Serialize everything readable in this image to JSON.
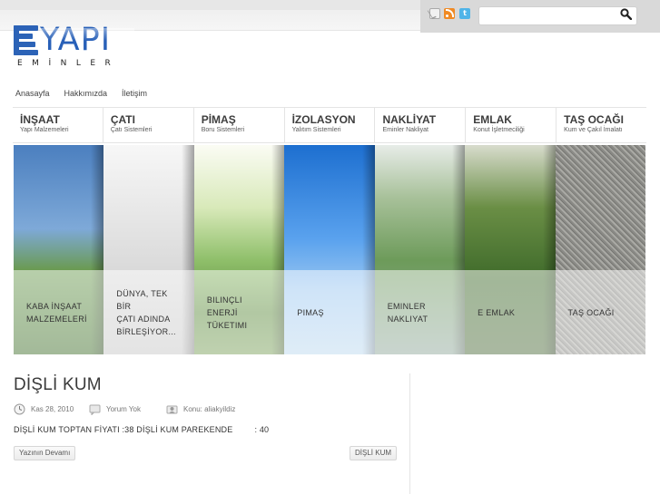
{
  "logo": {
    "word": "YAPI",
    "sub": "EMİNLER"
  },
  "top_icons": [
    "mail-icon",
    "rss-icon",
    "twitter-icon"
  ],
  "search": {
    "placeholder": "",
    "value": ""
  },
  "nav": [
    "Anasayfa",
    "Hakkımızda",
    "İletişim"
  ],
  "categories": [
    {
      "title": "İNŞAAT",
      "sub": "Yapı Malzemeleri"
    },
    {
      "title": "ÇATI",
      "sub": "Çatı Sistemleri"
    },
    {
      "title": "PİMAŞ",
      "sub": "Boru Sistemleri"
    },
    {
      "title": "İZOLASYON",
      "sub": "Yalıtım Sistemleri"
    },
    {
      "title": "NAKLİYAT",
      "sub": "Eminler Nakliyat"
    },
    {
      "title": "EMLAK",
      "sub": "Konut İşletmeciliği"
    },
    {
      "title": "TAŞ OCAĞI",
      "sub": "Kum ve Çakıl İmalatı"
    }
  ],
  "slides": [
    [
      "KABA İNŞAAT",
      "MALZEMELERİ"
    ],
    [
      "DÜNYA, TEK BİR",
      "ÇATI ADINDA",
      "BİRLEŞİYOR..."
    ],
    [
      "BILINÇLI ENERJİ",
      "TÜKETIMI"
    ],
    [
      "PIMAŞ"
    ],
    [
      "EMINLER",
      "NAKLIYAT"
    ],
    [
      "E EMLAK"
    ],
    [
      "TAŞ OCAĞI"
    ]
  ],
  "post": {
    "title": "DİŞLİ KUM",
    "date": "Kas 28, 2010",
    "comments": "Yorum Yok",
    "author": "Konu: aliakyildiz",
    "excerpt": "DİŞLİ KUM TOPTAN FİYATI :38 DİŞLİ KUM PAREKENDE",
    "excerpt_value": ": 40",
    "read_more": "Yazının Devamı",
    "tag": "DİŞLİ KUM"
  },
  "colors": {
    "logo_blue": "#2860b8",
    "text": "#333333"
  }
}
